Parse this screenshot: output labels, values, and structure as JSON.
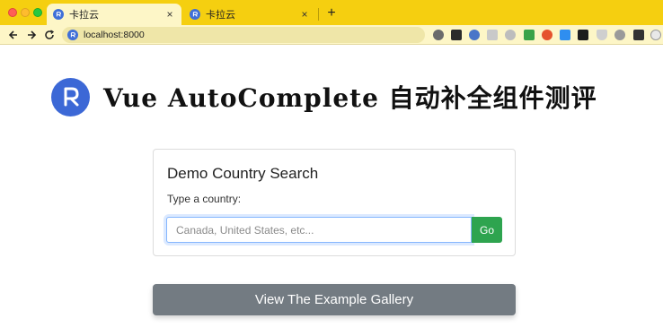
{
  "browser": {
    "tabs": [
      {
        "title": "卡拉云",
        "active": true,
        "icon": "karayun-favicon"
      },
      {
        "title": "卡拉云",
        "active": false,
        "icon": "karayun-favicon"
      }
    ],
    "close_glyph": "×",
    "new_tab_glyph": "+",
    "address_bar": {
      "url": "localhost:8000"
    },
    "extensions": [
      "ext-icon-1",
      "ext-icon-2",
      "ext-icon-3",
      "mail-icon",
      "ext-icon-5",
      "grid-icon",
      "ext-icon-7",
      "ext-icon-8",
      "ext-icon-9",
      "shield-icon",
      "ext-icon-11",
      "puzzle-icon",
      "profile-icon"
    ],
    "colors": {
      "tabstrip": "#f5cf10",
      "toolbar": "#fdf6c7"
    }
  },
  "page": {
    "hero_title": "Vue AutoComplete 自动补全组件测评",
    "card": {
      "title": "Demo Country Search",
      "label": "Type a country:",
      "input_placeholder": "Canada, United States, etc...",
      "input_value": "",
      "go_label": "Go"
    },
    "gallery_button": "View The Example Gallery",
    "colors": {
      "go": "#2ea44f",
      "gallery": "#737b82",
      "logo": "#3c68d6"
    }
  }
}
